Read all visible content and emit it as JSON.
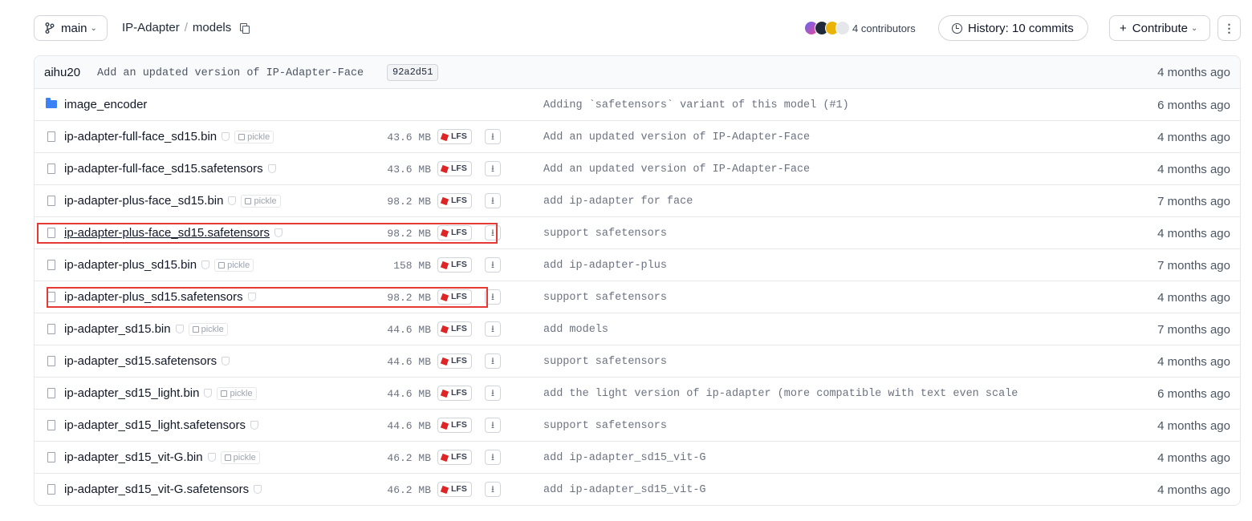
{
  "toolbar": {
    "branch": "main",
    "breadcrumb": {
      "repo": "IP-Adapter",
      "separator": "/",
      "folder": "models"
    },
    "contributors_label": "4 contributors",
    "history_label": "History: 10 commits",
    "contribute_label": "Contribute",
    "more_label": "⋮"
  },
  "last_commit": {
    "author": "aihu20",
    "message": "Add an updated version of IP-Adapter-Face",
    "sha": "92a2d51",
    "time": "4 months ago"
  },
  "files": [
    {
      "name": "image_encoder",
      "type": "folder",
      "commit": "Adding `safetensors` variant of this model (#1)",
      "time": "6 months ago"
    },
    {
      "name": "ip-adapter-full-face_sd15.bin",
      "type": "file",
      "pickle": "pickle",
      "size": "43.6 MB",
      "lfs": "LFS",
      "commit": "Add an updated version of IP-Adapter-Face",
      "time": "4 months ago"
    },
    {
      "name": "ip-adapter-full-face_sd15.safetensors",
      "type": "file",
      "size": "43.6 MB",
      "lfs": "LFS",
      "commit": "Add an updated version of IP-Adapter-Face",
      "time": "4 months ago"
    },
    {
      "name": "ip-adapter-plus-face_sd15.bin",
      "type": "file",
      "pickle": "pickle",
      "size": "98.2 MB",
      "lfs": "LFS",
      "commit": "add ip-adapter for face",
      "time": "7 months ago"
    },
    {
      "name": "ip-adapter-plus-face_sd15.safetensors",
      "type": "file",
      "size": "98.2 MB",
      "lfs": "LFS",
      "commit": "support safetensors",
      "time": "4 months ago",
      "highlight": true,
      "underline": true
    },
    {
      "name": "ip-adapter-plus_sd15.bin",
      "type": "file",
      "pickle": "pickle",
      "size": "158 MB",
      "lfs": "LFS",
      "commit": "add ip-adapter-plus",
      "time": "7 months ago"
    },
    {
      "name": "ip-adapter-plus_sd15.safetensors",
      "type": "file",
      "size": "98.2 MB",
      "lfs": "LFS",
      "commit": "support safetensors",
      "time": "4 months ago",
      "highlight": true
    },
    {
      "name": "ip-adapter_sd15.bin",
      "type": "file",
      "pickle": "pickle",
      "size": "44.6 MB",
      "lfs": "LFS",
      "commit": "add models",
      "time": "7 months ago"
    },
    {
      "name": "ip-adapter_sd15.safetensors",
      "type": "file",
      "size": "44.6 MB",
      "lfs": "LFS",
      "commit": "support safetensors",
      "time": "4 months ago"
    },
    {
      "name": "ip-adapter_sd15_light.bin",
      "type": "file",
      "pickle": "pickle",
      "size": "44.6 MB",
      "lfs": "LFS",
      "commit": "add the light version of ip-adapter (more compatible with text even scale",
      "time": "6 months ago"
    },
    {
      "name": "ip-adapter_sd15_light.safetensors",
      "type": "file",
      "size": "44.6 MB",
      "lfs": "LFS",
      "commit": "support safetensors",
      "time": "4 months ago"
    },
    {
      "name": "ip-adapter_sd15_vit-G.bin",
      "type": "file",
      "pickle": "pickle",
      "size": "46.2 MB",
      "lfs": "LFS",
      "commit": "add ip-adapter_sd15_vit-G",
      "time": "4 months ago"
    },
    {
      "name": "ip-adapter_sd15_vit-G.safetensors",
      "type": "file",
      "size": "46.2 MB",
      "lfs": "LFS",
      "commit": "add ip-adapter_sd15_vit-G",
      "time": "4 months ago"
    }
  ],
  "colors": {
    "highlight": "#e53935",
    "folder": "#3b82f6",
    "lfs": "#dc2626"
  }
}
